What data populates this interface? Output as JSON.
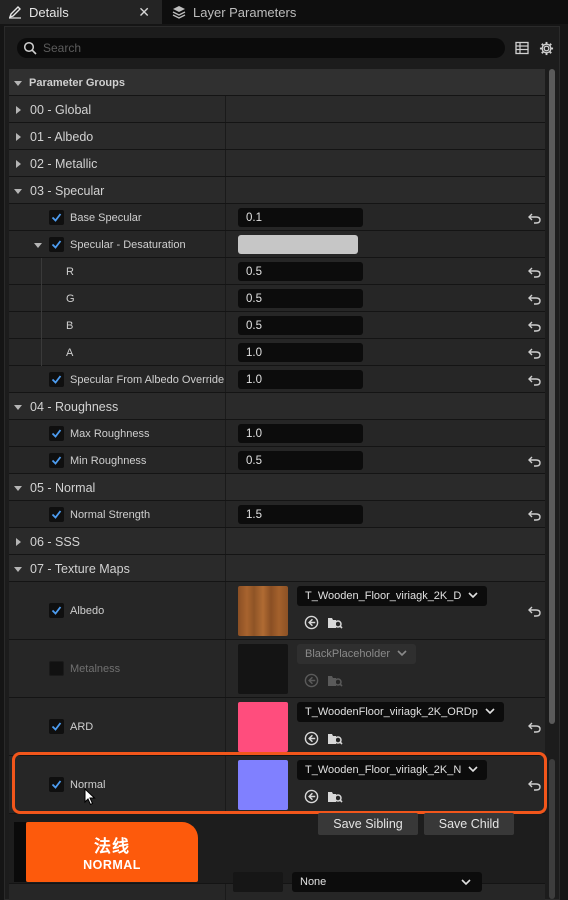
{
  "tabs": [
    {
      "label": "Details",
      "icon": "pencil-icon",
      "active": true
    },
    {
      "label": "Layer Parameters",
      "icon": "layers-icon",
      "active": false
    }
  ],
  "search": {
    "placeholder": "Search"
  },
  "header": {
    "label": "Parameter Groups"
  },
  "groups": {
    "global": "00 - Global",
    "albedo": "01 - Albedo",
    "metallic": "02 - Metallic",
    "specular": "03 - Specular",
    "roughness": "04 - Roughness",
    "normal": "05 - Normal",
    "sss": "06 - SSS",
    "texture_maps": "07 - Texture Maps"
  },
  "specular": {
    "base_specular": {
      "label": "Base Specular",
      "value": "0.1"
    },
    "desaturation": {
      "label": "Specular - Desaturation",
      "swatch": "#c6c6c6"
    },
    "r": {
      "label": "R",
      "value": "0.5"
    },
    "g": {
      "label": "G",
      "value": "0.5"
    },
    "b": {
      "label": "B",
      "value": "0.5"
    },
    "a": {
      "label": "A",
      "value": "1.0"
    },
    "from_albedo": {
      "label": "Specular From Albedo Override",
      "value": "1.0"
    }
  },
  "roughness": {
    "max": {
      "label": "Max Roughness",
      "value": "1.0"
    },
    "min": {
      "label": "Min Roughness",
      "value": "0.5"
    }
  },
  "normal": {
    "strength": {
      "label": "Normal Strength",
      "value": "1.5"
    }
  },
  "texture_maps": [
    {
      "label": "Albedo",
      "asset": "T_Wooden_Floor_viriagk_2K_D",
      "thumb_color": "#9a5a2a",
      "enabled": true
    },
    {
      "label": "Metalness",
      "asset": "BlackPlaceholder",
      "thumb_color": "#141414",
      "enabled": false
    },
    {
      "label": "ARD",
      "asset": "T_WoodenFloor_viriagk_2K_ORDp",
      "thumb_color": "#ff4d7d",
      "enabled": true
    },
    {
      "label": "Normal",
      "asset": "T_Wooden_Floor_viriagk_2K_N",
      "thumb_color": "#7f7fff",
      "enabled": true
    }
  ],
  "buttons": {
    "save_sibling": "Save Sibling",
    "save_child": "Save Child"
  },
  "bottom_combo": {
    "value": "None"
  },
  "badge": {
    "zh": "法线",
    "en": "NORMAL"
  },
  "colors": {
    "accent": "#f2561b",
    "badge": "#fd5a0c",
    "checkbox_tick": "#2e7bd6"
  }
}
